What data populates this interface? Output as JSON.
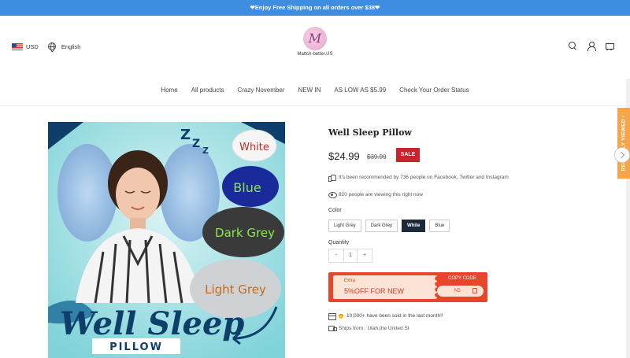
{
  "promo": {
    "text": "❤Enjoy Free Shipping on all orders over $38❤"
  },
  "header": {
    "currency": "USD",
    "language": "English",
    "logo_letter": "M",
    "logo_text": "Mattch-better.US",
    "icons": [
      "search-icon",
      "user-icon",
      "cart-icon"
    ]
  },
  "nav": {
    "items": [
      "Home",
      "All products",
      "Crazy November",
      "NEW IN",
      "AS LOW AS $5.99",
      "Check Your Order Status"
    ]
  },
  "product": {
    "title": "Well Sleep Pillow",
    "price": "$24.99",
    "old_price": "$39.99",
    "sale_badge": "SALE",
    "recommended": "It's been recommended by 736 people on Facebook, Twitter and Instagram",
    "viewing": "820 people are viewing this right now",
    "color_label": "Color",
    "colors": [
      "Light Grey",
      "Dark Grey",
      "White",
      "Blue"
    ],
    "selected_color": "White",
    "quantity_label": "Quantity",
    "quantity_minus": "-",
    "quantity_value": "1",
    "quantity_plus": "+",
    "coupon": {
      "extra": "Extra",
      "discount": "5%OFF FOR NEW",
      "copy_label": "COPY CODE",
      "code": "N5"
    },
    "sold": "10,000+ have been sold in the last month!!",
    "ships": "Ships from :  Utah,the United St"
  },
  "image": {
    "labels": [
      "White",
      "Blue",
      "Dark Grey",
      "Light Grey"
    ],
    "brand_script": "Well Sleep",
    "brand_sub": "PILLOW"
  },
  "sidebar": {
    "recently_viewed": "RECENTLY VIEWED ‹"
  },
  "colors": {
    "promo_bar": "#3d8ee0",
    "sale": "#c9232b",
    "coupon": "#e8462a",
    "recent_tab": "#f5a54a",
    "selected_color": "#1d2a3a"
  }
}
